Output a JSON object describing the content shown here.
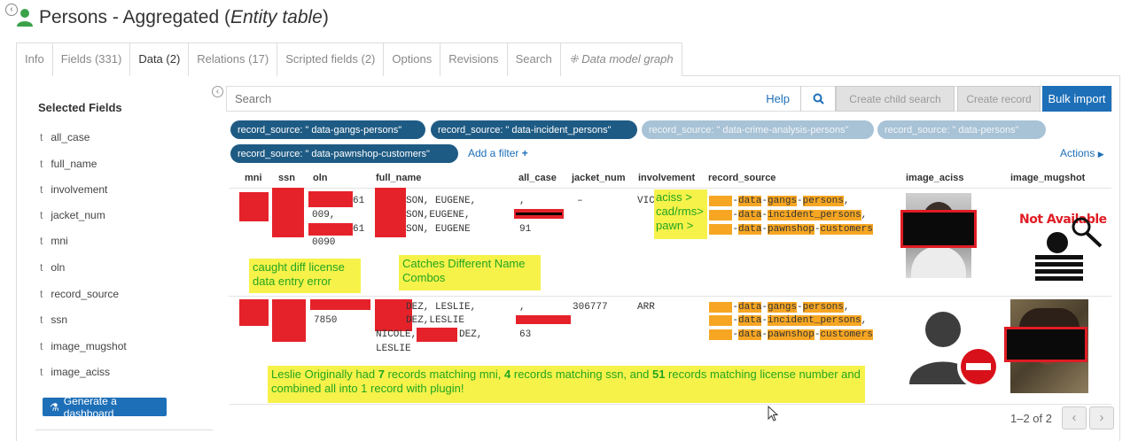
{
  "page": {
    "title_main": "Persons - Aggregated (",
    "title_italic": "Entity table",
    "title_close": ")"
  },
  "tabs": [
    "Info",
    "Fields (331)",
    "Data (2)",
    "Relations (17)",
    "Scripted fields (2)",
    "Options",
    "Revisions",
    "Search",
    "Data model graph"
  ],
  "sidebar": {
    "title": "Selected Fields",
    "type_glyph": "t",
    "fields": [
      "all_case",
      "full_name",
      "involvement",
      "jacket_num",
      "mni",
      "oln",
      "record_source",
      "ssn",
      "image_mugshot",
      "image_aciss"
    ],
    "dashboard_button": "Generate a dashboard"
  },
  "toolbar": {
    "search_placeholder": "Search",
    "help": "Help",
    "create_child_search": "Create child search",
    "create_record": "Create record",
    "bulk_import": "Bulk import"
  },
  "filters": [
    "record_source: \"    data-gangs-persons\"",
    "record_source: \"    data-incident_persons\"",
    "record_source: \"    data-crime-analysis-persons\"",
    "record_source: \"    data-persons\"",
    "record_source: \"    data-pawnshop-customers\""
  ],
  "add_filter": "Add a filter",
  "actions": "Actions",
  "columns": [
    "mni",
    "ssn",
    "oln",
    "full_name",
    "all_case",
    "jacket_num",
    "involvement",
    "record_source",
    "image_aciss",
    "image_mugshot"
  ],
  "row1": {
    "oln": [
      "61",
      "009,",
      "61",
      "0090"
    ],
    "names": [
      "SON, EUGENE,",
      "SON,EUGENE,",
      "SON, EUGENE"
    ],
    "all_case": [
      ",",
      "91"
    ],
    "jacket_num": "–",
    "involvement": "VIC",
    "sources": [
      [
        "data",
        "gangs",
        "persons"
      ],
      [
        "data",
        "incident_persons"
      ],
      [
        "data",
        "pawnshop",
        "customers"
      ]
    ],
    "mugshot_text": "Not Available"
  },
  "row2": {
    "oln": "7850",
    "names": [
      "DEZ, LESLIE,",
      "DEZ,LESLIE",
      "NICOLE,",
      "DEZ,",
      "LESLIE"
    ],
    "all_case": [
      ",",
      "63"
    ],
    "jacket_num": "306777",
    "involvement": "ARR",
    "sources": [
      [
        "data",
        "gangs",
        "persons"
      ],
      [
        "data",
        "incident_persons"
      ],
      [
        "data",
        "pawnshop",
        "customers"
      ]
    ]
  },
  "annotations": {
    "aciss_map": "aciss >\ncad/rms>\npawn >",
    "license": "caught diff license\ndata entry error",
    "names": "Catches Different Name\nCombos",
    "leslie_a": "Leslie Originally had ",
    "leslie_n1": "7",
    "leslie_b": " records matching mni, ",
    "leslie_n2": "4",
    "leslie_c": " records matching ssn, and ",
    "leslie_n3": "51",
    "leslie_d": " records matching license number and combined all into 1 record with plugin!"
  },
  "pagination": {
    "label": "1–2 of 2"
  },
  "colors": {
    "accent": "#1d6fb8",
    "pill": "#1e5b84",
    "highlight": "#f6a623",
    "note": "#f6f24a",
    "note_text": "#23a51f",
    "redact": "#e5222a"
  }
}
